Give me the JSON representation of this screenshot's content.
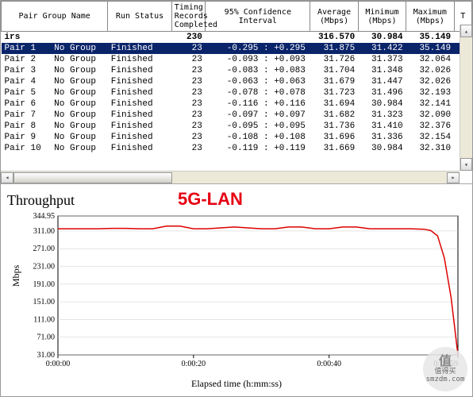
{
  "headers": {
    "pair": "Pair Group\nName",
    "status": "Run Status",
    "records": "Timing Records\nCompleted",
    "ci": "95% Confidence\nInterval",
    "avg": "Average\n(Mbps)",
    "min": "Minimum\n(Mbps)",
    "max": "Maximum\n(Mbps)"
  },
  "summary": {
    "label": "irs",
    "records": "230",
    "avg": "316.570",
    "min": "30.984",
    "max": "35.149"
  },
  "rows": [
    {
      "pair": "Pair 1",
      "group": "No Group",
      "status": "Finished",
      "records": "23",
      "ci": "-0.295 : +0.295",
      "avg": "31.875",
      "min": "31.422",
      "max": "35.149",
      "selected": true
    },
    {
      "pair": "Pair 2",
      "group": "No Group",
      "status": "Finished",
      "records": "23",
      "ci": "-0.093 : +0.093",
      "avg": "31.726",
      "min": "31.373",
      "max": "32.064"
    },
    {
      "pair": "Pair 3",
      "group": "No Group",
      "status": "Finished",
      "records": "23",
      "ci": "-0.083 : +0.083",
      "avg": "31.704",
      "min": "31.348",
      "max": "32.026"
    },
    {
      "pair": "Pair 4",
      "group": "No Group",
      "status": "Finished",
      "records": "23",
      "ci": "-0.063 : +0.063",
      "avg": "31.679",
      "min": "31.447",
      "max": "32.026"
    },
    {
      "pair": "Pair 5",
      "group": "No Group",
      "status": "Finished",
      "records": "23",
      "ci": "-0.078 : +0.078",
      "avg": "31.723",
      "min": "31.496",
      "max": "32.193"
    },
    {
      "pair": "Pair 6",
      "group": "No Group",
      "status": "Finished",
      "records": "23",
      "ci": "-0.116 : +0.116",
      "avg": "31.694",
      "min": "30.984",
      "max": "32.141"
    },
    {
      "pair": "Pair 7",
      "group": "No Group",
      "status": "Finished",
      "records": "23",
      "ci": "-0.097 : +0.097",
      "avg": "31.682",
      "min": "31.323",
      "max": "32.090"
    },
    {
      "pair": "Pair 8",
      "group": "No Group",
      "status": "Finished",
      "records": "23",
      "ci": "-0.095 : +0.095",
      "avg": "31.736",
      "min": "31.410",
      "max": "32.376"
    },
    {
      "pair": "Pair 9",
      "group": "No Group",
      "status": "Finished",
      "records": "23",
      "ci": "-0.108 : +0.108",
      "avg": "31.696",
      "min": "31.336",
      "max": "32.154"
    },
    {
      "pair": "Pair 10",
      "group": "No Group",
      "status": "Finished",
      "records": "23",
      "ci": "-0.119 : +0.119",
      "avg": "31.669",
      "min": "30.984",
      "max": "32.310"
    }
  ],
  "chart": {
    "title": "Throughput",
    "label": "5G-LAN",
    "ylabel": "Mbps",
    "xlabel": "Elapsed time (h:mm:ss)"
  },
  "chart_data": {
    "type": "line",
    "title": "Throughput",
    "xlabel": "Elapsed time (h:mm:ss)",
    "ylabel": "Mbps",
    "ylim": [
      31.0,
      344.95
    ],
    "yticks": [
      31.0,
      71.0,
      111.0,
      151.0,
      191.0,
      231.0,
      271.0,
      311.0,
      344.95
    ],
    "xticks": [
      "0:00:00",
      "0:00:20",
      "0:00:40",
      "0:00:59"
    ],
    "x_seconds": [
      0,
      2,
      4,
      6,
      8,
      10,
      12,
      14,
      16,
      18,
      20,
      22,
      24,
      26,
      28,
      30,
      32,
      34,
      36,
      38,
      40,
      42,
      44,
      46,
      48,
      50,
      52,
      54,
      55,
      56,
      57,
      58,
      59
    ],
    "values": [
      316,
      316,
      316,
      316,
      317,
      317,
      316,
      316,
      322,
      322,
      316,
      316,
      318,
      320,
      318,
      316,
      316,
      320,
      320,
      316,
      316,
      320,
      320,
      316,
      316,
      316,
      316,
      315,
      312,
      300,
      250,
      160,
      31
    ]
  },
  "watermark": {
    "line1": "值",
    "line2": "值得买",
    "line3": "smzdm.com"
  }
}
